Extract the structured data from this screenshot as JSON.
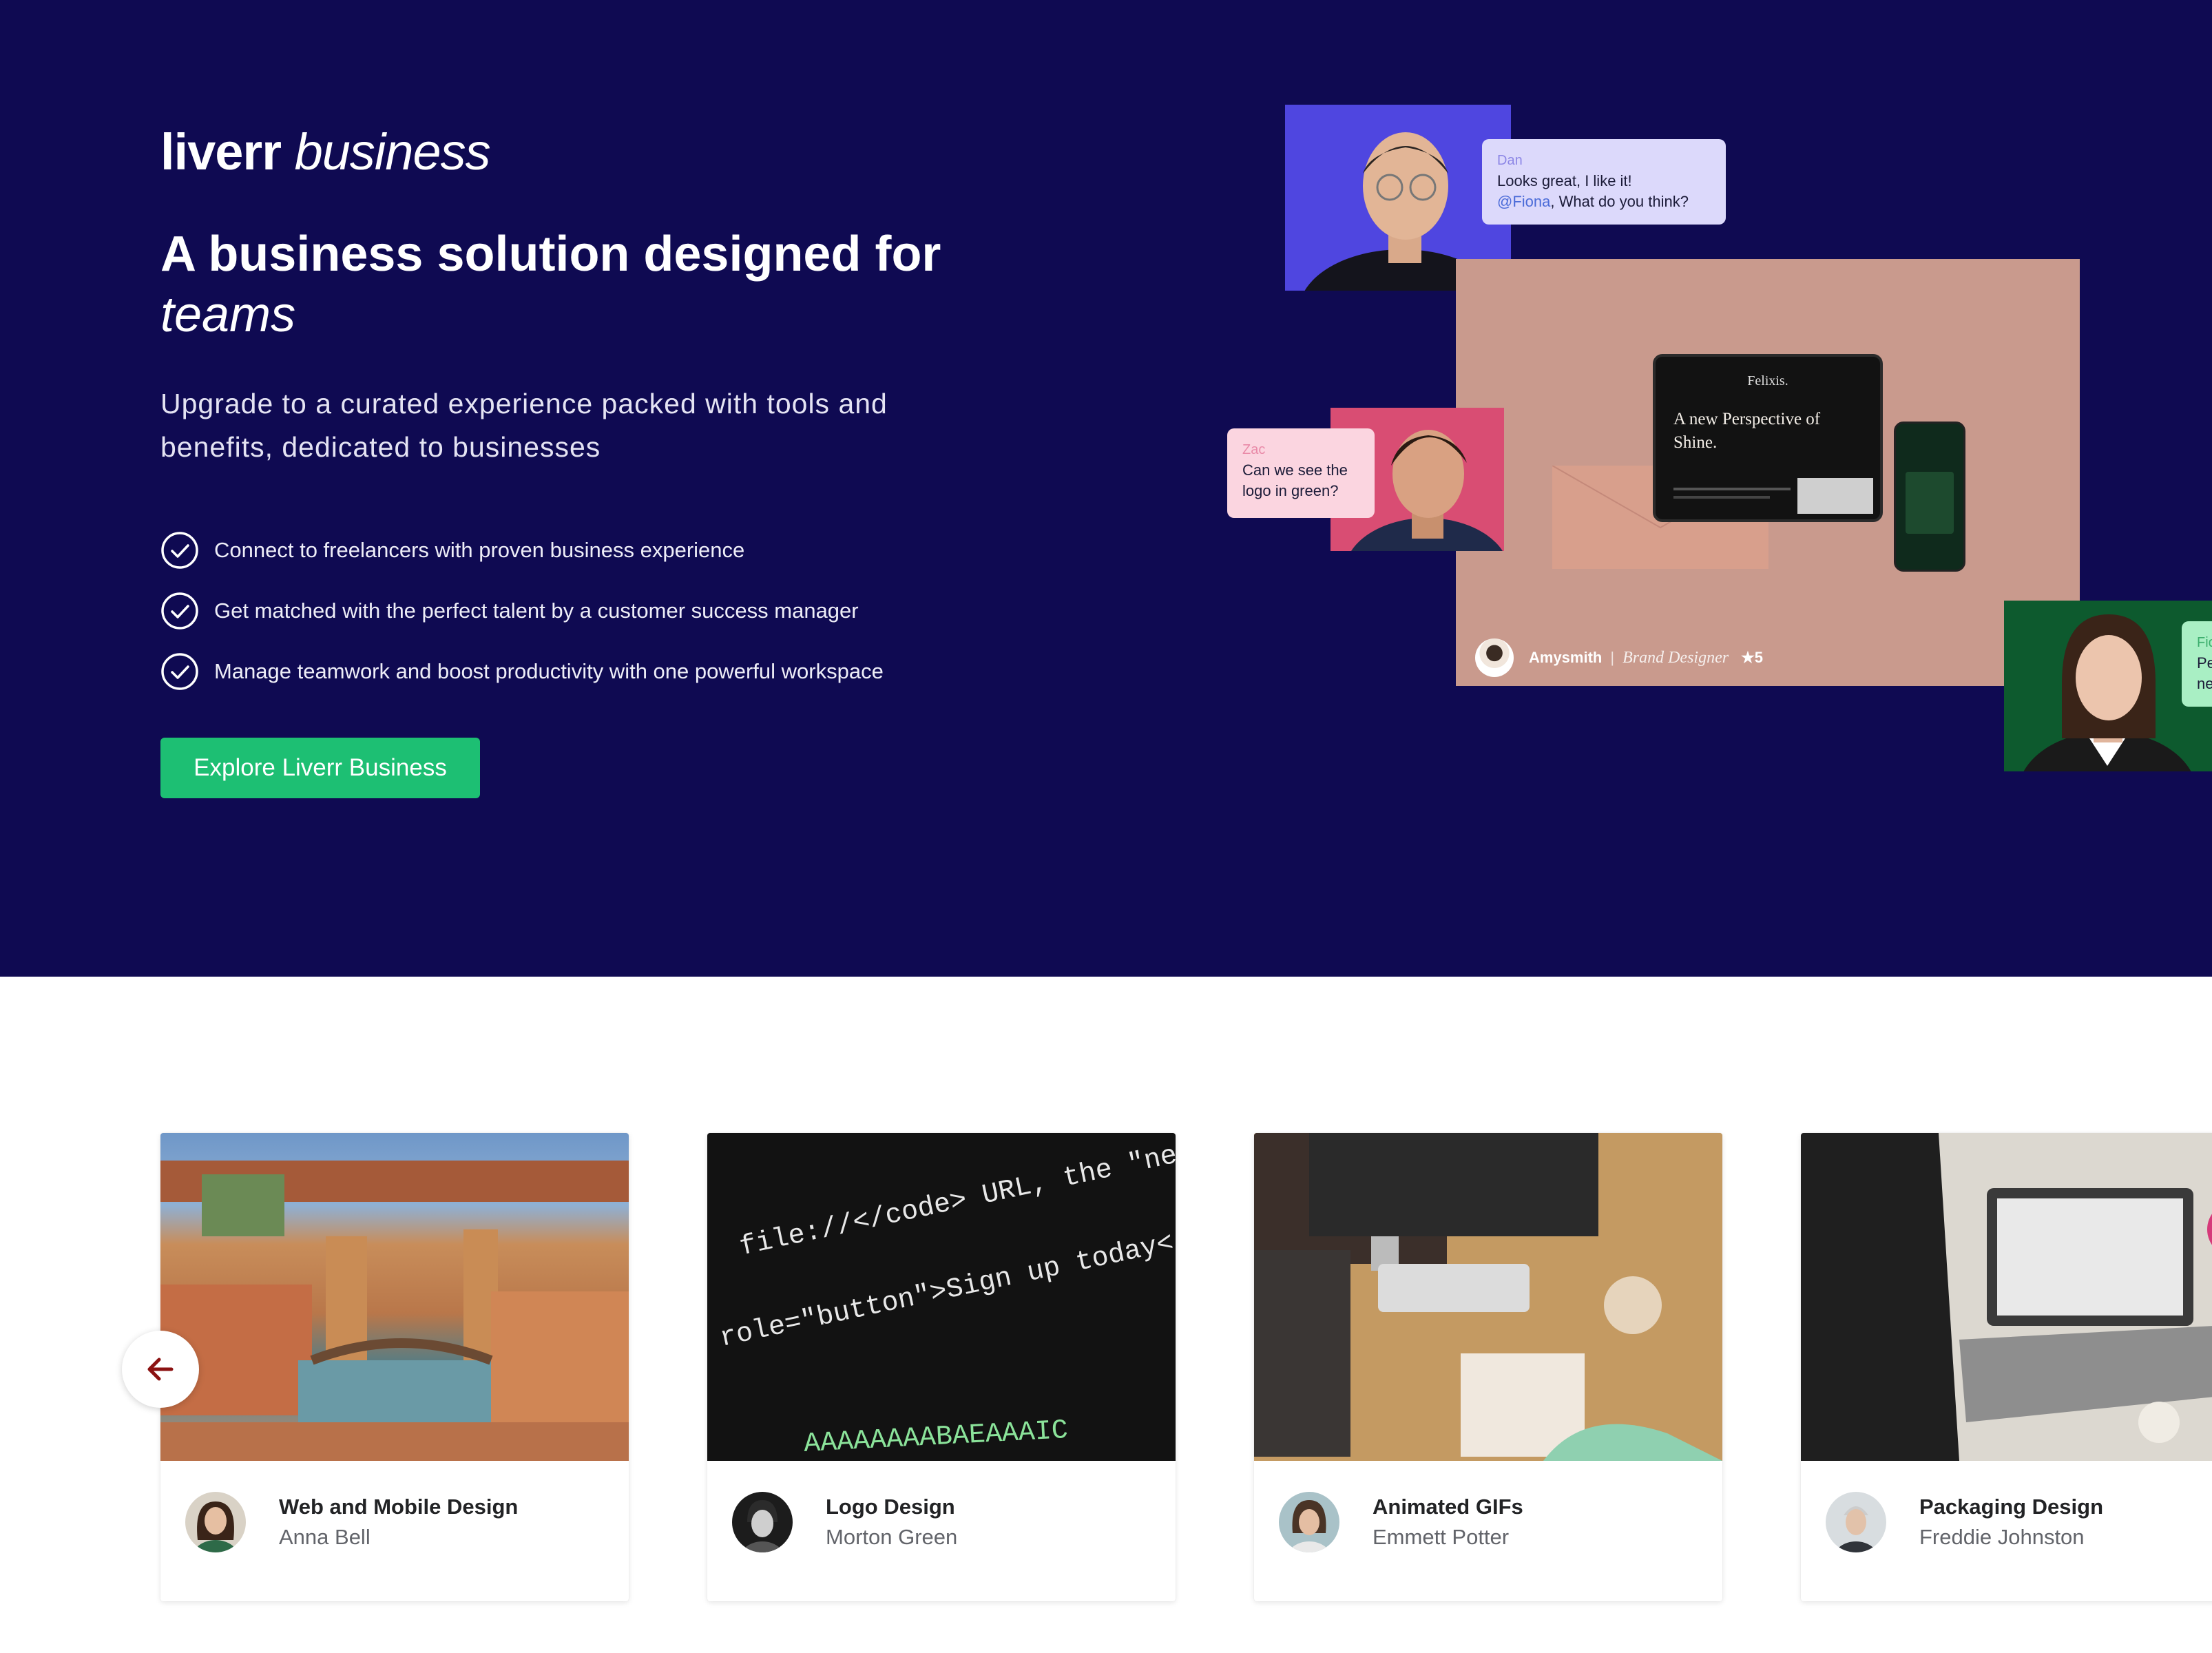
{
  "hero": {
    "logo_word": "liverr",
    "logo_suffix": "business",
    "headline": "A business solution designed for",
    "headline_italic": "teams",
    "subtitle": "Upgrade to a curated experience packed with tools and benefits, dedicated to businesses",
    "benefits": [
      "Connect to freelancers with proven business experience",
      "Get matched with the perfect talent by a customer success manager",
      "Manage teamwork and boost productivity with one powerful workspace"
    ],
    "cta_label": "Explore Liverr Business",
    "colors": {
      "background": "#0f0a52",
      "cta": "#1dbf73"
    }
  },
  "collage": {
    "chat_dan": {
      "name": "Dan",
      "text": "Looks great, I like it!",
      "mention": "@Fiona",
      "text_after": ", What do you think?"
    },
    "chat_zac": {
      "name": "Zac",
      "text": "Can we see the logo in green?"
    },
    "chat_fiona": {
      "name": "Fio",
      "text": "Pe",
      "text2": "ne"
    },
    "mockup_brand": "Felixis.",
    "mockup_headline": "A new Perspective of Shine.",
    "designer_name": "Amysmith",
    "designer_role": "Brand Designer",
    "designer_rating": "★5"
  },
  "carousel": {
    "prev_icon": "arrow-left-icon",
    "cards": [
      {
        "category": "Web and Mobile Design",
        "seller": "Anna Bell",
        "image": "venice-photo"
      },
      {
        "category": "Logo Design",
        "seller": "Morton Green",
        "image": "code-screen-photo"
      },
      {
        "category": "Animated GIFs",
        "seller": "Emmett Potter",
        "image": "desk-workspace-photo"
      },
      {
        "category": "Packaging Design",
        "seller": "Freddie Johnston",
        "image": "laptop-workspace-photo"
      }
    ],
    "code_lines": [
      "file://</code> URL, the \"next\"",
      "role=\"button\">Sign up today</a></p>",
      "AAAAAAAABAEAAAIC"
    ]
  }
}
